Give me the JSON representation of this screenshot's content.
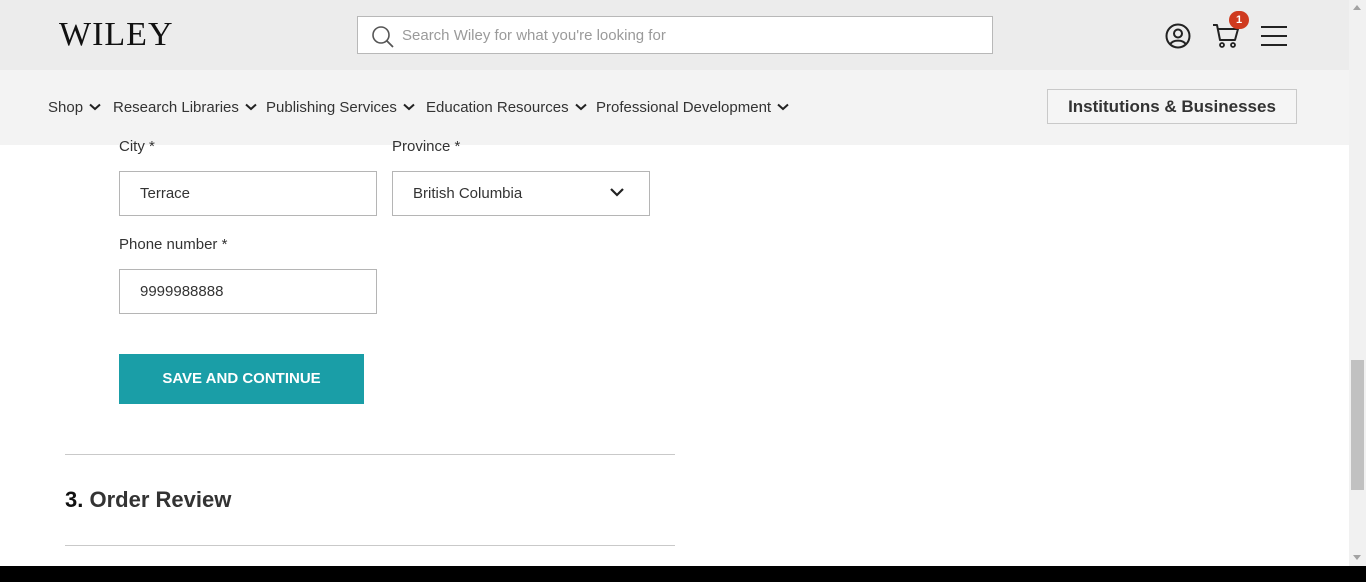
{
  "header": {
    "logo": "WILEY",
    "search_placeholder": "Search Wiley for what you're looking for",
    "cart_count": "1"
  },
  "nav": {
    "items": [
      {
        "label": "Shop"
      },
      {
        "label": "Research Libraries"
      },
      {
        "label": "Publishing Services"
      },
      {
        "label": "Education Resources"
      },
      {
        "label": "Professional Development"
      }
    ],
    "institutions_label": "Institutions & Businesses"
  },
  "form": {
    "city_label": "City",
    "city_value": "Terrace",
    "province_label": "Province",
    "province_value": "British Columbia",
    "phone_label": "Phone number *",
    "phone_value": "9999988888",
    "save_label": "SAVE AND CONTINUE"
  },
  "sections": {
    "order_review_number": "3.",
    "order_review_title": "Order Review"
  },
  "colors": {
    "accent": "#1a9ea7",
    "badge": "#cf3a1f",
    "header_bg": "#ececec",
    "nav_bg": "#f3f3f3"
  }
}
